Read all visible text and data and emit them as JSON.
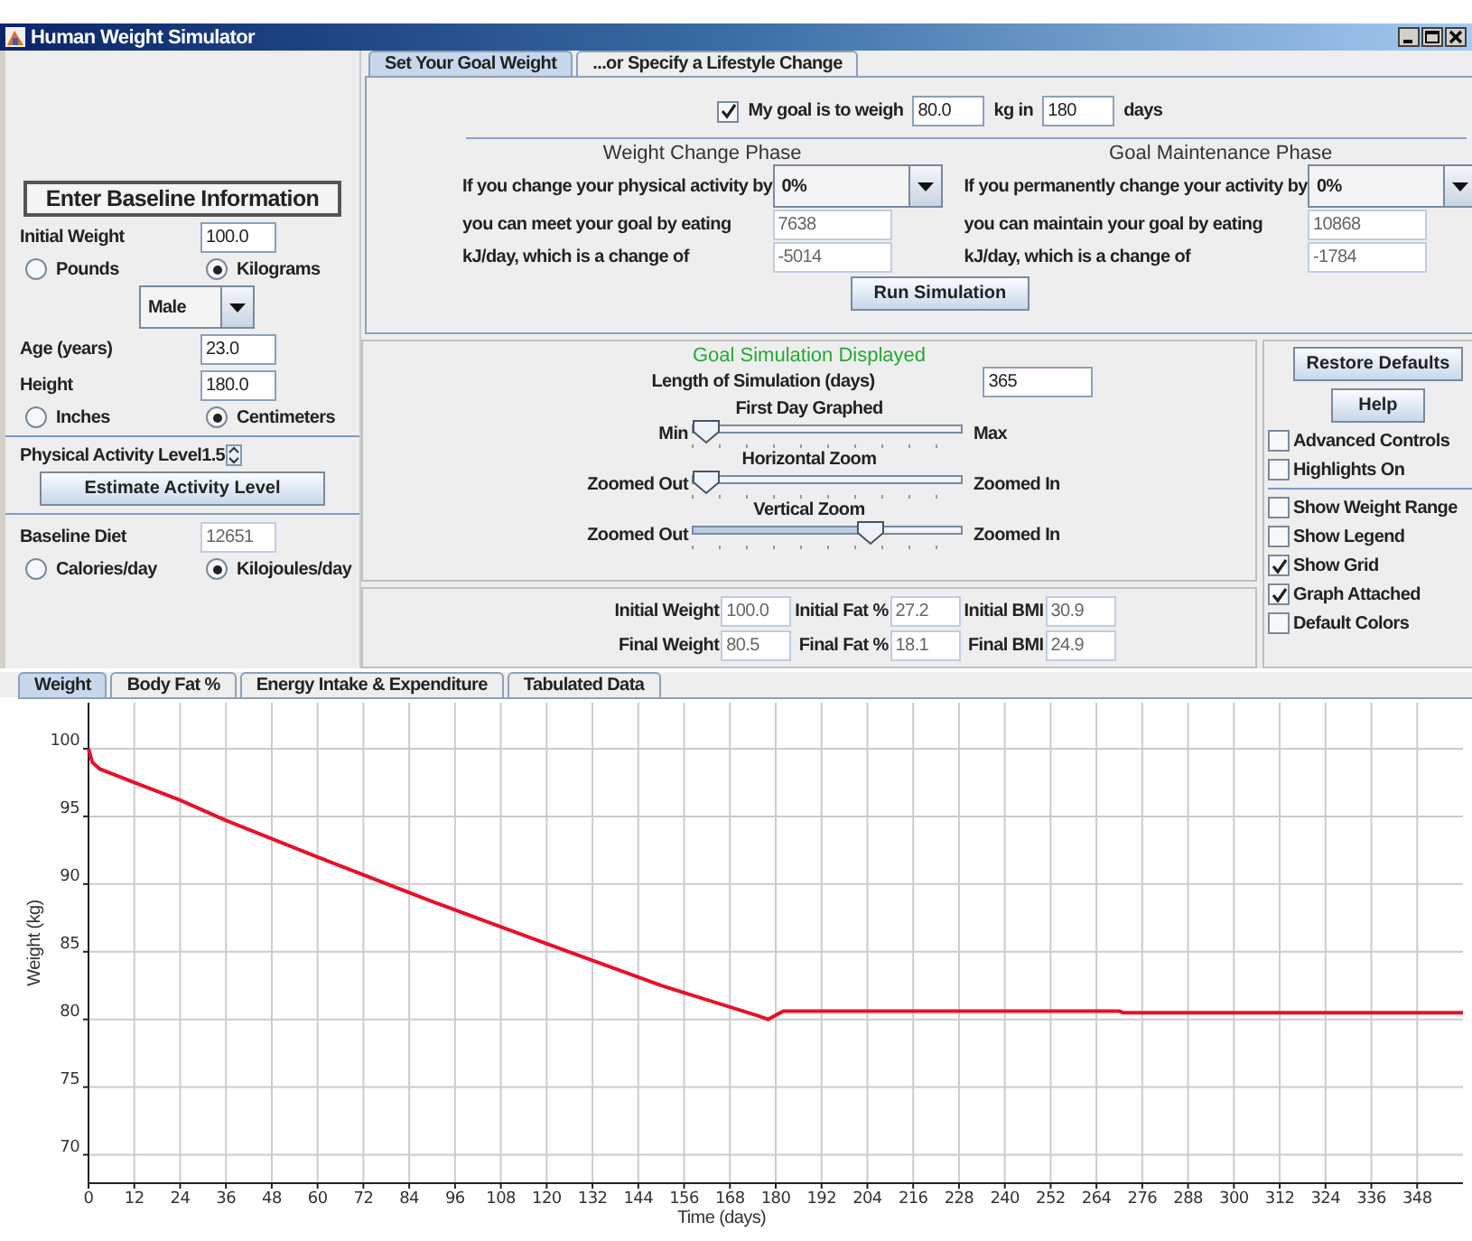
{
  "window": {
    "title": "Human Weight Simulator"
  },
  "baseline": {
    "header": "Enter Baseline Information",
    "initial_weight": {
      "label": "Initial Weight",
      "value": "100.0"
    },
    "weight_units": [
      {
        "label": "Pounds",
        "selected": false
      },
      {
        "label": "Kilograms",
        "selected": true
      }
    ],
    "sex": "Male",
    "age": {
      "label": "Age (years)",
      "value": "23.0"
    },
    "height": {
      "label": "Height",
      "value": "180.0"
    },
    "height_units": [
      {
        "label": "Inches",
        "selected": false
      },
      {
        "label": "Centimeters",
        "selected": true
      }
    ],
    "activity": {
      "label": "Physical Activity Level",
      "value": "1.5"
    },
    "estimate_button": "Estimate Activity Level",
    "diet": {
      "label": "Baseline Diet",
      "value": "12651"
    },
    "diet_units": [
      {
        "label": "Calories/day",
        "selected": false
      },
      {
        "label": "Kilojoules/day",
        "selected": true
      }
    ]
  },
  "goal_tabs": [
    {
      "label": "Set Your Goal Weight",
      "selected": true
    },
    {
      "label": "...or Specify a Lifestyle Change",
      "selected": false
    }
  ],
  "goal": {
    "checked": true,
    "text_1": "My goal is to weigh",
    "weight": "80.0",
    "text_2": "kg in",
    "days": "180",
    "text_3": "days"
  },
  "phases": [
    {
      "title": "Weight Change Phase",
      "activity_label": "If you change your physical activity by",
      "activity": "0%",
      "eat_label": "you can meet your goal by eating",
      "intake": "7638",
      "change_label": "kJ/day, which is a change of",
      "change": "-5014"
    },
    {
      "title": "Goal Maintenance Phase",
      "activity_label": "If you permanently change your activity by",
      "activity": "0%",
      "eat_label": "you can maintain your goal by eating",
      "intake": "10868",
      "change_label": "kJ/day, which is a change of",
      "change": "-1784"
    }
  ],
  "run_button": "Run Simulation",
  "simulation": {
    "status": "Goal Simulation Displayed",
    "length_label": "Length of Simulation (days)",
    "length": "365",
    "sliders": [
      {
        "title": "First Day Graphed",
        "min_label": "Min",
        "max_label": "Max",
        "level": 0
      },
      {
        "title": "Horizontal Zoom",
        "min_label": "Zoomed Out",
        "max_label": "Zoomed In",
        "level": 0
      },
      {
        "title": "Vertical Zoom",
        "min_label": "Zoomed Out",
        "max_label": "Zoomed In",
        "level": 0.68
      }
    ]
  },
  "results": [
    {
      "label": "Initial Weight",
      "value": "100.0"
    },
    {
      "label": "Initial Fat %",
      "value": "27.2"
    },
    {
      "label": "Initial BMI",
      "value": "30.9"
    },
    {
      "label": "Final Weight",
      "value": "80.5"
    },
    {
      "label": "Final Fat %",
      "value": "18.1"
    },
    {
      "label": "Final BMI",
      "value": "24.9"
    }
  ],
  "options": {
    "buttons": [
      "Restore Defaults",
      "Help"
    ],
    "checks": [
      {
        "label": "Advanced Controls",
        "checked": false
      },
      {
        "label": "Highlights On",
        "checked": false
      }
    ],
    "display_checks": [
      {
        "label": "Show Weight Range",
        "checked": false
      },
      {
        "label": "Show Legend",
        "checked": false
      },
      {
        "label": "Show Grid",
        "checked": true
      },
      {
        "label": "Graph Attached",
        "checked": true
      },
      {
        "label": "Default Colors",
        "checked": false
      }
    ]
  },
  "graph_tabs": [
    {
      "label": "Weight",
      "selected": true
    },
    {
      "label": "Body Fat %",
      "selected": false
    },
    {
      "label": "Energy Intake & Expenditure",
      "selected": false
    },
    {
      "label": "Tabulated Data",
      "selected": false
    }
  ],
  "chart_data": {
    "type": "line",
    "xlabel": "Time (days)",
    "ylabel": "Weight (kg)",
    "x": [
      0,
      1,
      3,
      12,
      24,
      36,
      60,
      90,
      120,
      150,
      175,
      178,
      182,
      270,
      271,
      360
    ],
    "series": [
      {
        "color": "#e8102a",
        "values": [
          100,
          99,
          98.5,
          97.5,
          96.2,
          94.7,
          92,
          88.7,
          85.6,
          82.5,
          80.3,
          80,
          80.6,
          80.6,
          80.5,
          80.5
        ]
      }
    ],
    "xlim": [
      0,
      360
    ],
    "ylim": [
      67.9,
      103.4
    ],
    "xticks": [
      0,
      12,
      24,
      36,
      48,
      60,
      72,
      84,
      96,
      108,
      120,
      132,
      144,
      156,
      168,
      180,
      192,
      204,
      216,
      228,
      240,
      252,
      264,
      276,
      288,
      300,
      312,
      324,
      336,
      348
    ],
    "grid": true,
    "yticks": [
      70,
      75,
      80,
      85,
      90,
      95,
      100
    ]
  }
}
